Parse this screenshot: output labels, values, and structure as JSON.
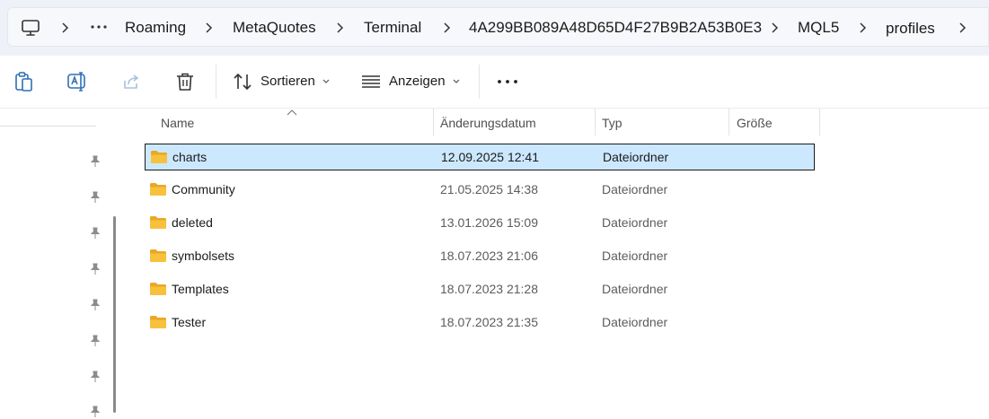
{
  "breadcrumb": {
    "items": [
      "Roaming",
      "MetaQuotes",
      "Terminal",
      "4A299BB089A48D65D4F27B9B2A53B0E3",
      "MQL5",
      "profiles"
    ]
  },
  "toolbar": {
    "sort_label": "Sortieren",
    "view_label": "Anzeigen"
  },
  "columns": {
    "name": "Name",
    "date": "Änderungsdatum",
    "type": "Typ",
    "size": "Größe"
  },
  "files": [
    {
      "name": "charts",
      "date": "12.09.2025 12:41",
      "type": "Dateiordner",
      "selected": true
    },
    {
      "name": "Community",
      "date": "21.05.2025 14:38",
      "type": "Dateiordner"
    },
    {
      "name": "deleted",
      "date": "13.01.2026 15:09",
      "type": "Dateiordner"
    },
    {
      "name": "symbolsets",
      "date": "18.07.2023 21:06",
      "type": "Dateiordner"
    },
    {
      "name": "Templates",
      "date": "18.07.2023 21:28",
      "type": "Dateiordner"
    },
    {
      "name": "Tester",
      "date": "18.07.2023 21:35",
      "type": "Dateiordner"
    }
  ],
  "colors": {
    "selection": "#cce8ff",
    "folder": "#f8c13c"
  }
}
